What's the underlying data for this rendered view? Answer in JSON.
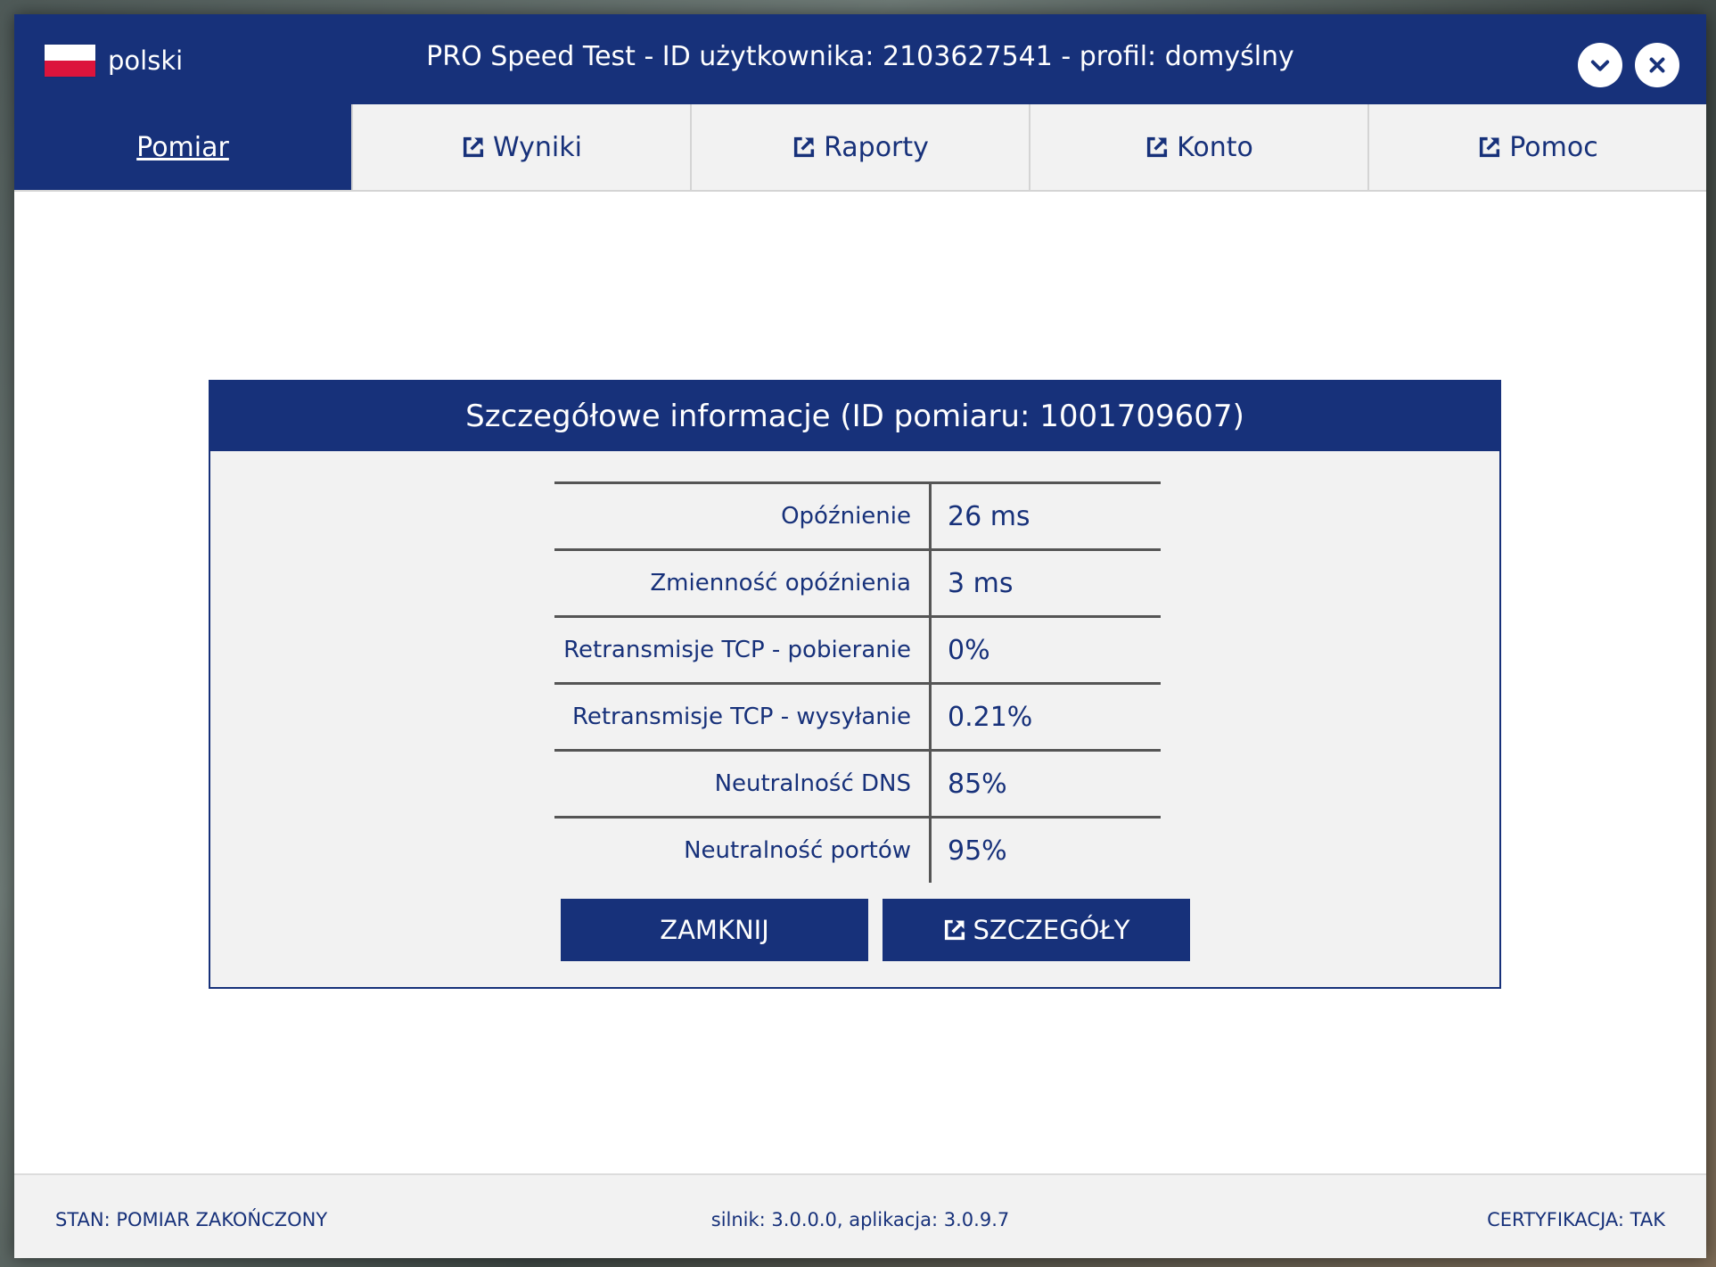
{
  "window": {
    "language": "polski",
    "title": "PRO Speed Test - ID użytkownika: 2103627541 - profil: domyślny"
  },
  "tabs": [
    {
      "label": "Pomiar",
      "active": true,
      "icon": "external-link-icon"
    },
    {
      "label": "Wyniki",
      "active": false,
      "icon": "external-link-icon"
    },
    {
      "label": "Raporty",
      "active": false,
      "icon": "external-link-icon"
    },
    {
      "label": "Konto",
      "active": false,
      "icon": "external-link-icon"
    },
    {
      "label": "Pomoc",
      "active": false,
      "icon": "external-link-icon"
    }
  ],
  "dialog": {
    "title": "Szczegółowe informacje (ID pomiaru: 1001709607)",
    "rows": [
      {
        "label": "Opóźnienie",
        "value": "26 ms"
      },
      {
        "label": "Zmienność opóźnienia",
        "value": "3 ms"
      },
      {
        "label": "Retransmisje TCP - pobieranie",
        "value": "0%"
      },
      {
        "label": "Retransmisje TCP - wysyłanie",
        "value": "0.21%"
      },
      {
        "label": "Neutralność DNS",
        "value": "85%"
      },
      {
        "label": "Neutralność portów",
        "value": "95%"
      }
    ],
    "close_label": "ZAMKNIJ",
    "details_label": "SZCZEGÓŁY"
  },
  "status": {
    "state": "STAN: POMIAR ZAKOŃCZONY",
    "version": "silnik: 3.0.0.0, aplikacja: 3.0.9.7",
    "certification": "CERTYFIKACJA: TAK"
  },
  "colors": {
    "primary": "#17317a",
    "panel": "#f2f2f2"
  }
}
